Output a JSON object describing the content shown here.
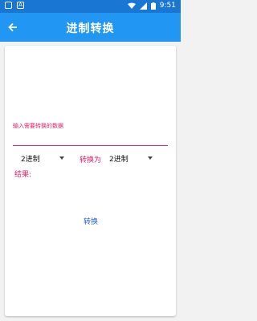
{
  "statusbar": {
    "left_icons": [
      "notification-box-icon",
      "a-icon"
    ],
    "time": "9:51"
  },
  "appbar": {
    "title": "进制转换"
  },
  "form": {
    "input_label": "输入需要转换的数据",
    "input_value": "",
    "from_base": "2进制",
    "convert_to_label": "转换为",
    "to_base": "2进制",
    "result_label": "结果:",
    "result_value": "",
    "convert_button": "转换"
  },
  "colors": {
    "appbar": "#2196f3",
    "statusbar": "#1976d2",
    "accent": "#e91e63",
    "button_text": "#1e63d6"
  }
}
